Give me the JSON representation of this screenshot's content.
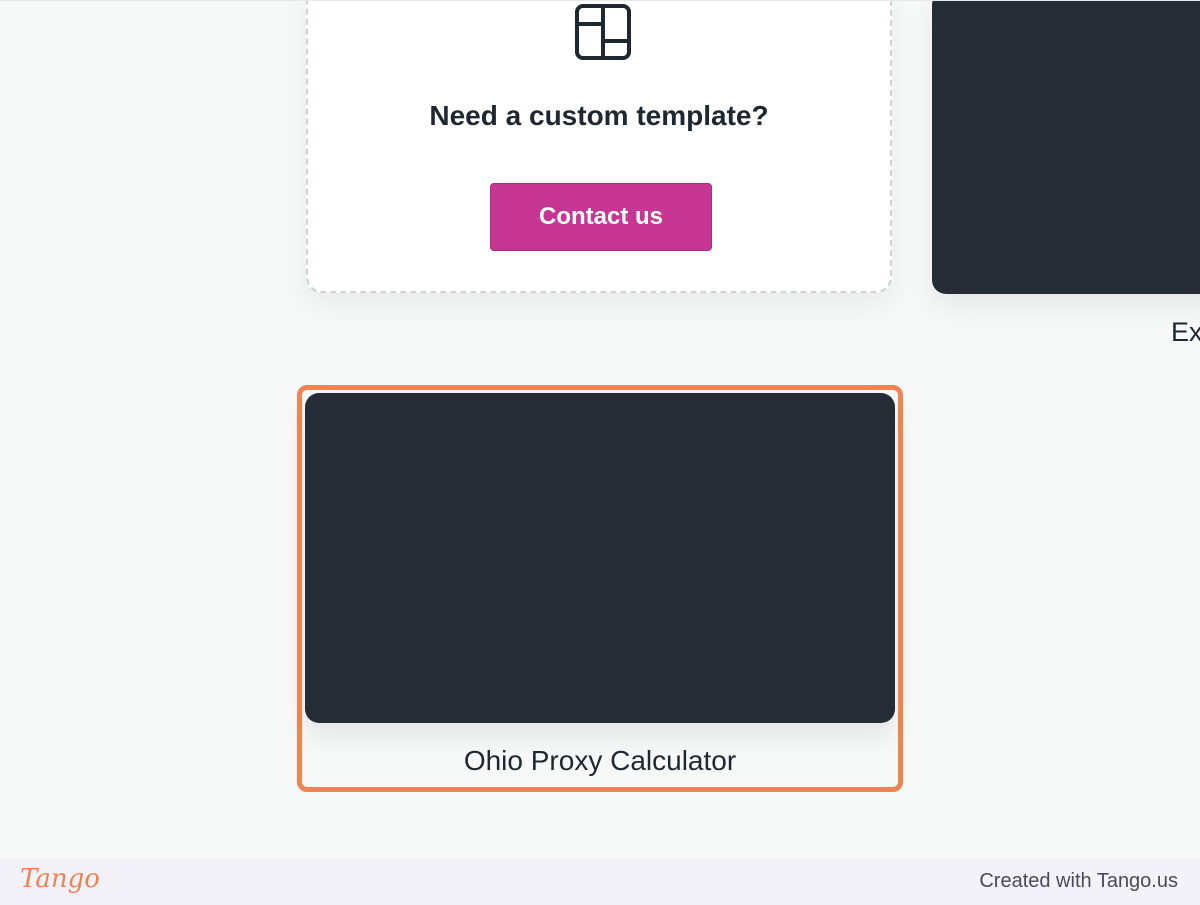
{
  "custom_template": {
    "icon": "layout-template-icon",
    "title": "Need a custom template?",
    "contact_button": "Contact us"
  },
  "cards": [
    {
      "label": "Ex"
    },
    {
      "label": "Ohio Proxy Calculator"
    }
  ],
  "footer": {
    "logo_text": "Tango",
    "created_with": "Created with Tango.us"
  },
  "colors": {
    "button": "#c83693",
    "card_dark": "#252c36",
    "highlight": "#ef8354",
    "text": "#1f2731"
  }
}
